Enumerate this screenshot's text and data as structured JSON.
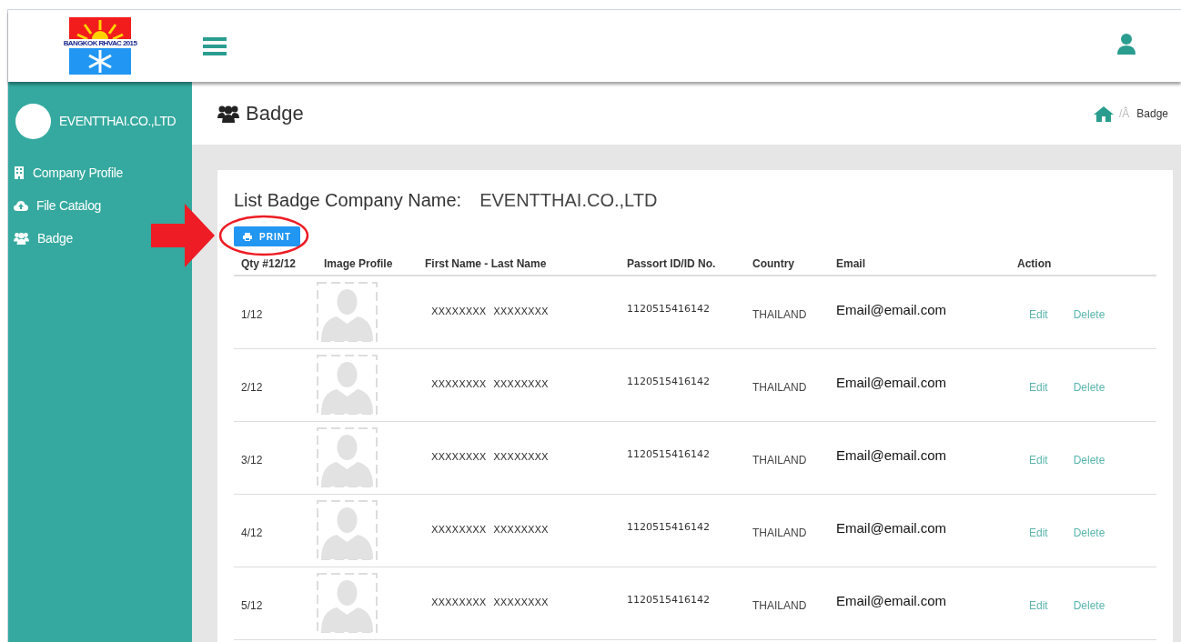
{
  "logo": {
    "text": "BANGKOK RHVAC 2015"
  },
  "sidebar": {
    "company": "EVENTTHAI.CO.,LTD",
    "items": [
      {
        "kind": "building",
        "label": "Company Profile"
      },
      {
        "kind": "upload",
        "label": "File Catalog"
      },
      {
        "kind": "users",
        "label": "Badge"
      }
    ]
  },
  "page": {
    "title": "Badge",
    "breadcrumb": [
      "/Â",
      "Badge"
    ]
  },
  "card": {
    "title": "List Badge Company Name:",
    "company": "EVENTTHAI.CO.,LTD",
    "print_button": "PRINT"
  },
  "table": {
    "columns": [
      "Qty #12/12",
      "Image Profile",
      "First Name - Last Name",
      "Passort ID/ID No.",
      "Country",
      "Email",
      "Action"
    ],
    "rows": [
      {
        "qty": "1/12",
        "first": "XXXXXXXX",
        "last": "XXXXXXXX",
        "id": "1120515416142",
        "country": "THAILAND",
        "email": "Email@email.com",
        "actions": [
          "Edit",
          "Delete"
        ]
      },
      {
        "qty": "2/12",
        "first": "XXXXXXXX",
        "last": "XXXXXXXX",
        "id": "1120515416142",
        "country": "THAILAND",
        "email": "Email@email.com",
        "actions": [
          "Edit",
          "Delete"
        ]
      },
      {
        "qty": "3/12",
        "first": "XXXXXXXX",
        "last": "XXXXXXXX",
        "id": "1120515416142",
        "country": "THAILAND",
        "email": "Email@email.com",
        "actions": [
          "Edit",
          "Delete"
        ]
      },
      {
        "qty": "4/12",
        "first": "XXXXXXXX",
        "last": "XXXXXXXX",
        "id": "1120515416142",
        "country": "THAILAND",
        "email": "Email@email.com",
        "actions": [
          "Edit",
          "Delete"
        ]
      },
      {
        "qty": "5/12",
        "first": "XXXXXXXX",
        "last": "XXXXXXXX",
        "id": "1120515416142",
        "country": "THAILAND",
        "email": "Email@email.com",
        "actions": [
          "Edit",
          "Delete"
        ]
      }
    ]
  }
}
